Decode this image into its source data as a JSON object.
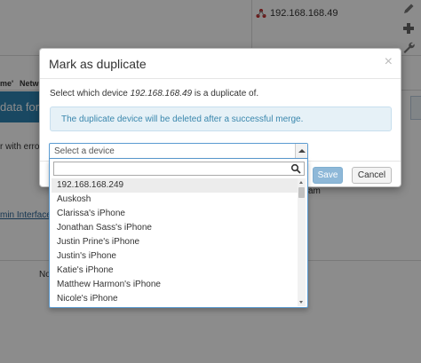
{
  "background": {
    "device_ip": "192.168.168.49",
    "header_cells": [
      "me'",
      "Netwo"
    ],
    "bluebar_text": "data for th",
    "row_text": "r with error",
    "link_text": "min Interface",
    "am_text": "am",
    "no_text": "No"
  },
  "modal": {
    "title": "Mark as duplicate",
    "close_glyph": "×",
    "message_prefix": "Select which device ",
    "message_device": "192.168.168.49",
    "message_suffix": " is a duplicate of.",
    "info_text": "The duplicate device will be deleted after a successful merge.",
    "save_label": "Save",
    "cancel_label": "Cancel"
  },
  "select": {
    "placeholder": "Select a device",
    "search_value": "",
    "options": [
      "192.168.168.249",
      "Auskosh",
      "Clarissa's iPhone",
      "Jonathan Sass's iPhone",
      "Justin Prine's iPhone",
      "Justin's iPhone",
      "Katie's iPhone",
      "Matthew Harmon's iPhone",
      "Nicole's iPhone"
    ]
  },
  "colors": {
    "accent": "#2f83b2",
    "info_bg": "#e6f1f7",
    "info_text": "#3a87ad"
  },
  "icons": [
    "network-device-icon",
    "pencil-icon",
    "plus-icon",
    "wrench-icon",
    "search-icon"
  ]
}
